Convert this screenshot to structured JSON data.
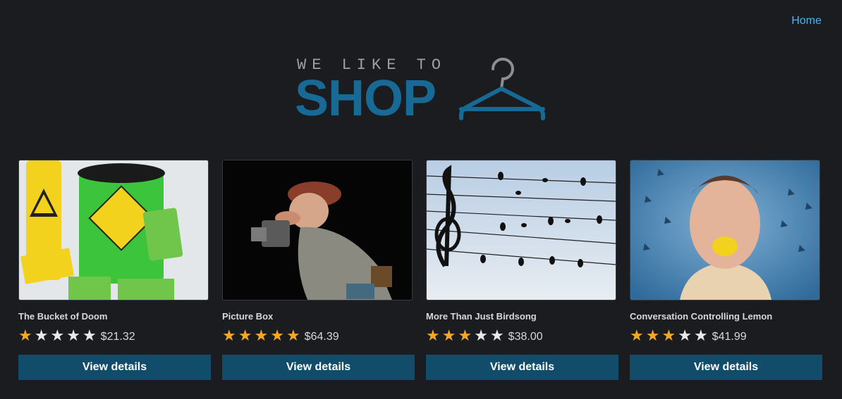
{
  "nav": {
    "home_label": "Home"
  },
  "logo": {
    "tagline": "WE LIKE TO",
    "wordmark": "SHOP",
    "brand_color": "#176a96"
  },
  "products": [
    {
      "name": "The Bucket of Doom",
      "rating": 1,
      "max_rating": 5,
      "price": "$21.32",
      "button_label": "View details"
    },
    {
      "name": "Picture Box",
      "rating": 5,
      "max_rating": 5,
      "price": "$64.39",
      "button_label": "View details"
    },
    {
      "name": "More Than Just Birdsong",
      "rating": 3,
      "max_rating": 5,
      "price": "$38.00",
      "button_label": "View details"
    },
    {
      "name": "Conversation Controlling Lemon",
      "rating": 3,
      "max_rating": 5,
      "price": "$41.99",
      "button_label": "View details"
    }
  ],
  "colors": {
    "background": "#1b1c1f",
    "link": "#4db3f5",
    "button": "#124c6b",
    "star_on": "#f5a623",
    "star_off": "#e9e9e9"
  }
}
